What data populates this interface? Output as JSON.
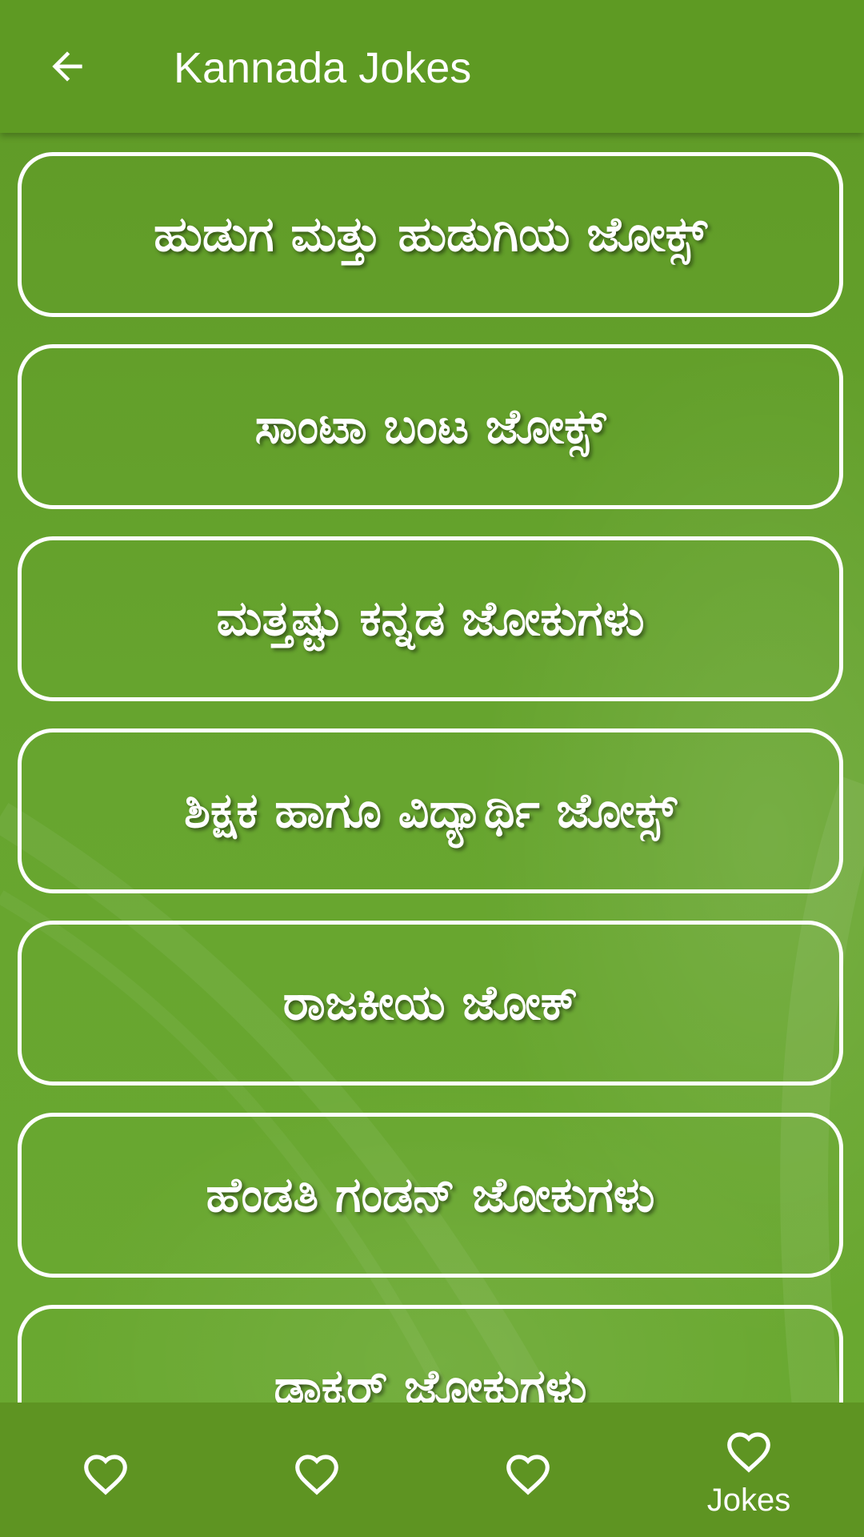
{
  "app_bar": {
    "title": "Kannada Jokes",
    "back_icon": "arrow-left-icon"
  },
  "categories": [
    {
      "label": "ಹುಡುಗ ಮತ್ತು ಹುಡುಗಿಯ ಜೋಕ್ಸ್"
    },
    {
      "label": "ಸಾಂಟಾ ಬಂಟ ಜೋಕ್ಸ್"
    },
    {
      "label": "ಮತ್ತಷ್ಟು ಕನ್ನಡ ಜೋಕುಗಳು"
    },
    {
      "label": "ಶಿಕ್ಷಕ ಹಾಗೂ ವಿದ್ಯಾರ್ಥಿ ಜೋಕ್ಸ್"
    },
    {
      "label": "ರಾಜಕೀಯ ಜೋಕ್"
    },
    {
      "label": "ಹೆಂಡತಿ ಗಂಡನ್ ಜೋಕುಗಳು"
    },
    {
      "label": "ಡಾಕ್ಟರ್ ಜೋಕುಗಳು"
    }
  ],
  "bottom_nav": {
    "items": [
      {
        "icon": "heart-outline-icon",
        "label": ""
      },
      {
        "icon": "heart-outline-icon",
        "label": ""
      },
      {
        "icon": "heart-outline-icon",
        "label": ""
      },
      {
        "icon": "heart-outline-icon",
        "label": "Jokes",
        "active": true
      }
    ]
  },
  "colors": {
    "app_bar": "#5e9a23",
    "background": "#65a22d",
    "bottom_nav": "#5e9422",
    "foreground": "#ffffff"
  }
}
